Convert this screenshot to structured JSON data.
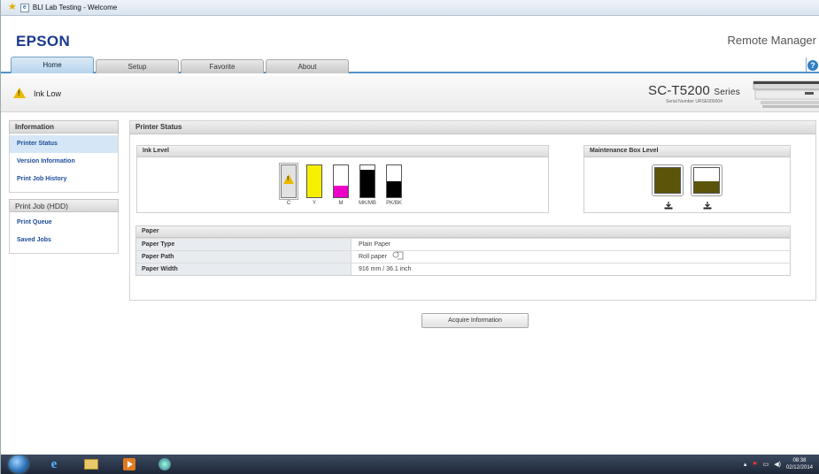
{
  "browser": {
    "title": "BLI Lab Testing - Welcome"
  },
  "header": {
    "brand": "EPSON",
    "app_name": "Remote Manager"
  },
  "tabs": [
    {
      "label": "Home"
    },
    {
      "label": "Setup"
    },
    {
      "label": "Favorite"
    },
    {
      "label": "About"
    }
  ],
  "status": {
    "message": "Ink Low",
    "model": "SC-T5200",
    "series": "Series",
    "serial": "Serial Number URSE000004"
  },
  "sidebar": {
    "sections": [
      {
        "title": "Information",
        "items": [
          {
            "label": "Printer Status"
          },
          {
            "label": "Version Information"
          },
          {
            "label": "Print Job History"
          }
        ]
      },
      {
        "title": "Print Job (HDD)",
        "items": [
          {
            "label": "Print Queue"
          },
          {
            "label": "Saved Jobs"
          }
        ]
      }
    ]
  },
  "main": {
    "title": "Printer Status",
    "ink": {
      "title": "Ink Level",
      "cartridges": [
        {
          "label": "C",
          "color": "#00aeef",
          "level": 0.0,
          "warning": true
        },
        {
          "label": "Y",
          "color": "#f7ef00",
          "level": 1.0,
          "warning": false
        },
        {
          "label": "M",
          "color": "#ec00c8",
          "level": 0.35,
          "warning": false
        },
        {
          "label": "MK/MB",
          "color": "#000000",
          "level": 0.85,
          "warning": false
        },
        {
          "label": "PK/BK",
          "color": "#000000",
          "level": 0.5,
          "warning": false
        }
      ]
    },
    "maintenance": {
      "title": "Maintenance Box Level",
      "boxes": [
        {
          "level": 1.0,
          "color": "#5c5408"
        },
        {
          "level": 0.45,
          "color": "#5c5408"
        }
      ]
    },
    "paper": {
      "title": "Paper",
      "rows": [
        {
          "key": "Paper Type",
          "value": "Plain Paper"
        },
        {
          "key": "Paper Path",
          "value": "Roll paper"
        },
        {
          "key": "Paper Width",
          "value": "916 mm / 36.1 inch"
        }
      ]
    },
    "acquire_label": "Acquire Information"
  },
  "taskbar": {
    "time": "08:38",
    "date": "02/12/2014"
  }
}
